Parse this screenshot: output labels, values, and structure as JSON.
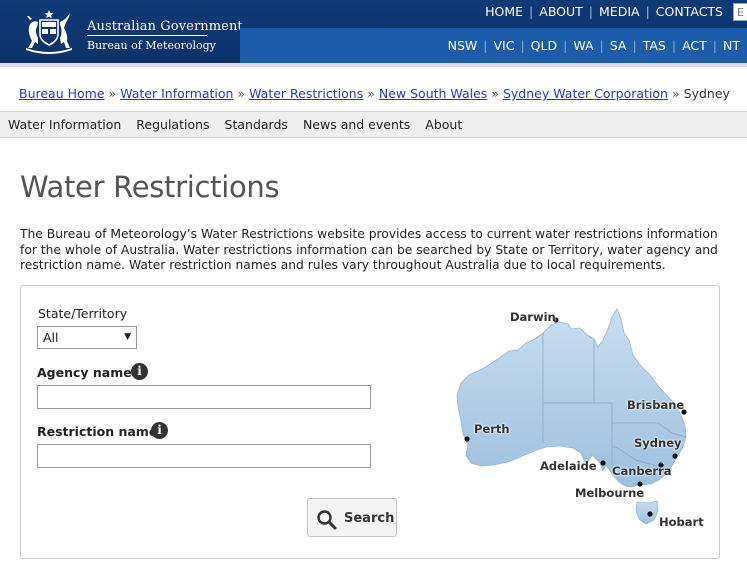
{
  "header": {
    "gov_title": "Australian Government",
    "gov_subtitle": "Bureau of Meteorology",
    "top_links": [
      "HOME",
      "ABOUT",
      "MEDIA",
      "CONTACTS"
    ],
    "search_stub": "E",
    "states": [
      "NSW",
      "VIC",
      "QLD",
      "WA",
      "SA",
      "TAS",
      "ACT",
      "NT"
    ],
    "brand_color": "#0f3a78",
    "state_bar_color": "#1c5cad"
  },
  "breadcrumb": {
    "links": [
      "Bureau Home",
      "Water Information",
      "Water Restrictions",
      "New South Wales",
      "Sydney Water Corporation"
    ],
    "separator": "»",
    "current": "Sydney"
  },
  "subnav": [
    "Water Information",
    "Regulations",
    "Standards",
    "News and events",
    "About"
  ],
  "page": {
    "title": "Water Restrictions",
    "intro": "The Bureau of Meteorology’s Water Restrictions website provides access to current water restrictions information for the whole of Australia. Water restrictions information can be searched by State or Territory, water agency and restriction name. Water restriction names and rules vary throughout Australia due to local requirements."
  },
  "search": {
    "state_label": "State/Territory",
    "state_value": "All",
    "agency_label": "Agency name",
    "agency_value": "",
    "restriction_label": "Restriction name",
    "restriction_value": "",
    "info_icon_glyph": "i",
    "button_label": "Search"
  },
  "map": {
    "cities": [
      "Darwin",
      "Brisbane",
      "Perth",
      "Sydney",
      "Adelaide",
      "Canberra",
      "Melbourne",
      "Hobart"
    ],
    "fill_color": "#a9c9e3"
  }
}
